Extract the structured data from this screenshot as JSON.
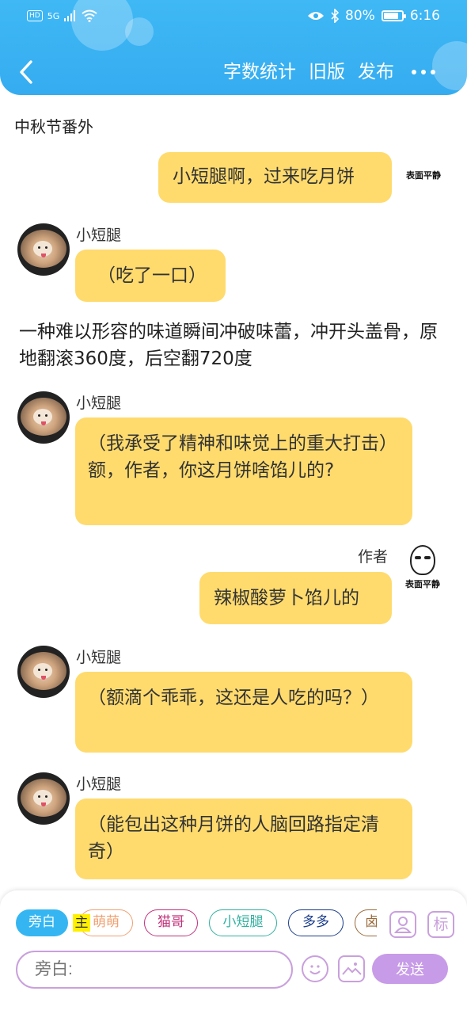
{
  "status_bar": {
    "network": "5G",
    "hd_badge": "HD",
    "battery_text": "80%",
    "battery_level": 0.8,
    "time": "6:16"
  },
  "toolbar": {
    "word_count": "字数统计",
    "old_version": "旧版",
    "publish": "发布"
  },
  "chapter_title": "中秋节番外",
  "meme_caption": "表面平静",
  "messages": [
    {
      "side": "right",
      "speaker": "",
      "text": "小短腿啊，过来吃月饼"
    },
    {
      "side": "left",
      "speaker": "小短腿",
      "text": "（吃了一口）"
    },
    {
      "side": "narration",
      "text": "一种难以形容的味道瞬间冲破味蕾，冲开头盖骨，原地翻滚360度，后空翻720度"
    },
    {
      "side": "left",
      "speaker": "小短腿",
      "text": "（我承受了精神和味觉上的重大打击）额，作者，你这月饼啥馅儿的?"
    },
    {
      "side": "right",
      "speaker": "作者",
      "text": "辣椒酸萝卜馅儿的"
    },
    {
      "side": "left",
      "speaker": "小短腿",
      "text": "（额滴个乖乖，这还是人吃的吗？）"
    },
    {
      "side": "left",
      "speaker": "小短腿",
      "text": "（能包出这种月饼的人脑回路指定清奇）"
    }
  ],
  "role_chips": [
    {
      "label": "旁白",
      "active": true,
      "color": "#35b6f2"
    },
    {
      "label": "萌萌",
      "active": false,
      "color": "#f0a070"
    },
    {
      "label": "猫哥",
      "active": false,
      "color": "#c0307a"
    },
    {
      "label": "小短腿",
      "active": false,
      "color": "#30b0a0"
    },
    {
      "label": "多多",
      "active": false,
      "color": "#1a3c8a"
    },
    {
      "label": "卤",
      "active": false,
      "color": "#9a6a3a"
    }
  ],
  "owner_tag": "主",
  "side_buttons": {
    "tag_label": "标"
  },
  "input": {
    "placeholder": "旁白:"
  },
  "send_label": "发送",
  "colors": {
    "header": "#3fb8f5",
    "bubble": "#ffdb6e",
    "accent_purple": "#c79be7"
  }
}
